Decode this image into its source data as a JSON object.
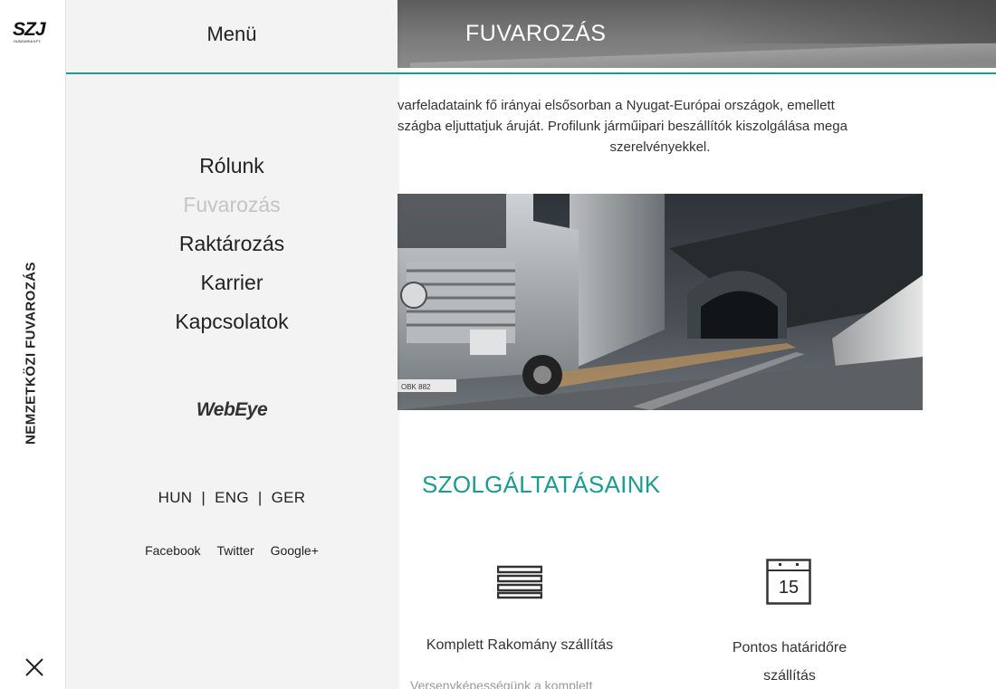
{
  "rail": {
    "logo_alt": "SZJ",
    "logo_sub": "HUNGARIA KFT.",
    "vertical_title": "NEMZETKÖZI FUVAROZÁS",
    "close_icon": "close-icon"
  },
  "page": {
    "banner_title": "FUVAROZÁS",
    "intro_line1": "varfeladataink fő irányai elsősorban a Nyugat-Európai országok, emellett",
    "intro_line2": "szágba eljuttatjuk áruját. Profilunk járműipari beszállítók kiszolgálása mega",
    "intro_line3": "szerelvényekkel.",
    "truck_plate": "OBK 882",
    "services_title": "SZOLGÁLTATÁSAINK",
    "service1_icon": "cargo-stack-icon",
    "service1_label": "Komplett Rakomány szállítás",
    "service2_icon": "calendar-icon",
    "service2_day": "15",
    "service2_label_line1": "Pontos határidőre",
    "service2_label_line2": "szállítás",
    "service1_desc": "Versenyképességünk a komplett"
  },
  "menu": {
    "title": "Menü",
    "items": [
      {
        "label": "Rólunk"
      },
      {
        "label": "Fuvarozás"
      },
      {
        "label": "Raktározás"
      },
      {
        "label": "Karrier"
      },
      {
        "label": "Kapcsolatok"
      }
    ],
    "webeye": "WebEye",
    "languages": [
      "HUN",
      "ENG",
      "GER"
    ],
    "lang_separator": "|",
    "social": [
      "Facebook",
      "Twitter",
      "Google+"
    ]
  },
  "colors": {
    "accent": "#1b9c8f",
    "active_menu": "#c4c4c4",
    "panel_bg": "#f3f3f3"
  }
}
